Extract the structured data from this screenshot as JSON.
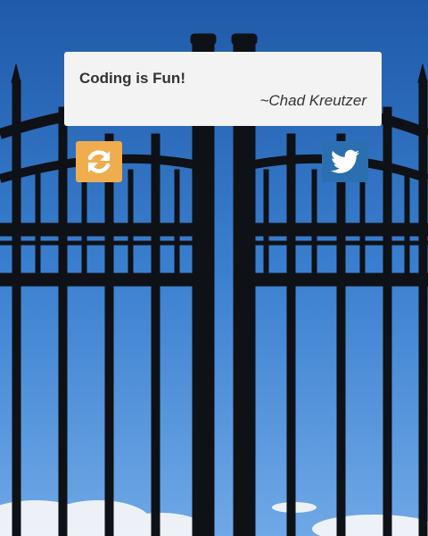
{
  "quote": {
    "text": "Coding is Fun!",
    "author": "~Chad Kreutzer"
  },
  "buttons": {
    "refresh": {
      "icon": "refresh-icon",
      "color": "#f0ad4e"
    },
    "tweet": {
      "icon": "twitter-icon",
      "color": "#2a6fb0"
    }
  },
  "background": {
    "subject": "black iron gate against blue sky",
    "sky_color": "#2f6fbf",
    "gate_color": "#0e1116"
  }
}
